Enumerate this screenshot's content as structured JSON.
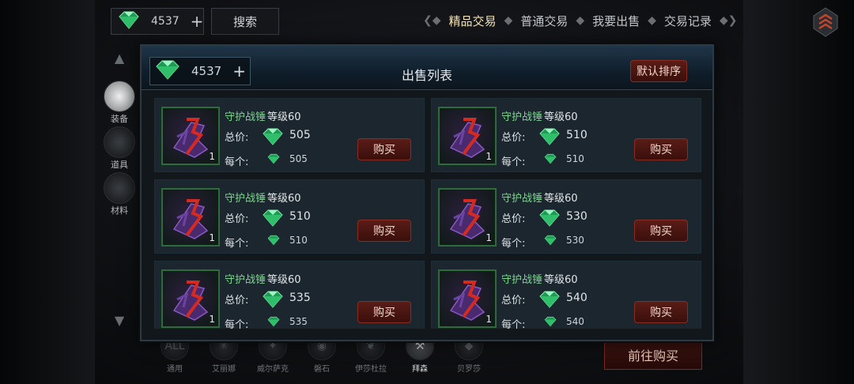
{
  "top_bar": {
    "currency_amount": "4537",
    "plus": "+",
    "search_label": "搜索",
    "tabs": [
      {
        "label": "精品交易",
        "active": true
      },
      {
        "label": "普通交易",
        "active": false
      },
      {
        "label": "我要出售",
        "active": false
      },
      {
        "label": "交易记录",
        "active": false
      }
    ]
  },
  "side_nav": {
    "items": [
      {
        "label": "装备",
        "active": true
      },
      {
        "label": "道具",
        "active": false
      },
      {
        "label": "材料",
        "active": false
      }
    ]
  },
  "bottom_nav": {
    "items": [
      {
        "label": "通用",
        "glyph": "ALL",
        "active": false
      },
      {
        "label": "艾丽娜",
        "glyph": "✳",
        "active": false
      },
      {
        "label": "威尔萨克",
        "glyph": "✦",
        "active": false
      },
      {
        "label": "磐石",
        "glyph": "◉",
        "active": false
      },
      {
        "label": "伊莎杜拉",
        "glyph": "❦",
        "active": false
      },
      {
        "label": "拜森",
        "glyph": "⚒",
        "active": true
      },
      {
        "label": "贝罗莎",
        "glyph": "◆",
        "active": false
      }
    ],
    "goto_buy_label": "前往购买"
  },
  "modal": {
    "title": "出售列表",
    "currency_amount": "4537",
    "plus": "+",
    "sort_label": "默认排序",
    "total_label": "总价:",
    "each_label": "每个:",
    "buy_label": "购买",
    "listings": [
      {
        "name": "守护战锤",
        "level": "等级60",
        "total": "505",
        "each": "505",
        "qty": "1"
      },
      {
        "name": "守护战锤",
        "level": "等级60",
        "total": "510",
        "each": "510",
        "qty": "1"
      },
      {
        "name": "守护战锤",
        "level": "等级60",
        "total": "510",
        "each": "510",
        "qty": "1"
      },
      {
        "name": "守护战锤",
        "level": "等级60",
        "total": "530",
        "each": "530",
        "qty": "1"
      },
      {
        "name": "守护战锤",
        "level": "等级60",
        "total": "535",
        "each": "535",
        "qty": "1"
      },
      {
        "name": "守护战锤",
        "level": "等级60",
        "total": "540",
        "each": "540",
        "qty": "1"
      }
    ]
  },
  "colors": {
    "gem": "#2fbf6a",
    "item_name": "#78d98b",
    "button_red": "#5a1c17",
    "active_tab": "#f2e3b8"
  }
}
